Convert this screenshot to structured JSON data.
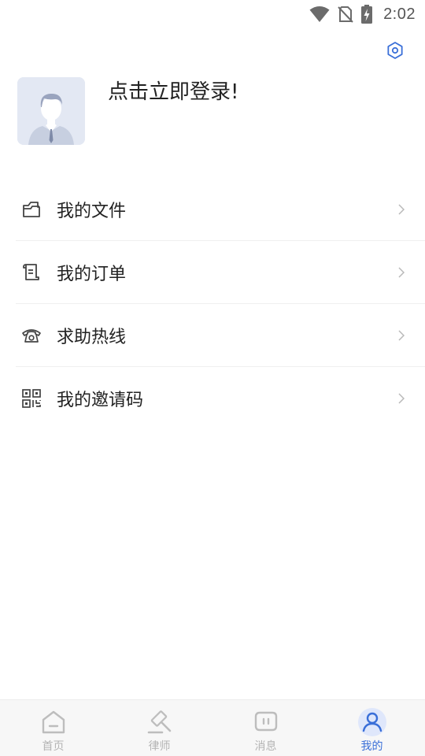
{
  "status_bar": {
    "time": "2:02",
    "icons": [
      "wifi-icon",
      "no-sim-icon",
      "battery-charging-icon"
    ]
  },
  "header": {
    "settings_icon": "settings-hexagon-icon"
  },
  "profile": {
    "avatar_icon": "default-avatar-icon",
    "login_prompt": "点击立即登录!"
  },
  "menu": {
    "items": [
      {
        "label": "我的文件",
        "icon": "folder-icon"
      },
      {
        "label": "我的订单",
        "icon": "order-scroll-icon"
      },
      {
        "label": "求助热线",
        "icon": "telephone-icon"
      },
      {
        "label": "我的邀请码",
        "icon": "qr-code-icon"
      }
    ]
  },
  "tab_bar": {
    "tabs": [
      {
        "label": "首页",
        "icon": "home-icon",
        "active": false
      },
      {
        "label": "律师",
        "icon": "gavel-icon",
        "active": false
      },
      {
        "label": "消息",
        "icon": "message-icon",
        "active": false
      },
      {
        "label": "我的",
        "icon": "user-icon",
        "active": true
      }
    ]
  },
  "colors": {
    "accent": "#3a6fd8",
    "inactive": "#b4b4b4",
    "text": "#222222",
    "divider": "#efefef",
    "tab_bar_bg": "#f7f7f7",
    "avatar_bg": "#e3e8f3"
  }
}
